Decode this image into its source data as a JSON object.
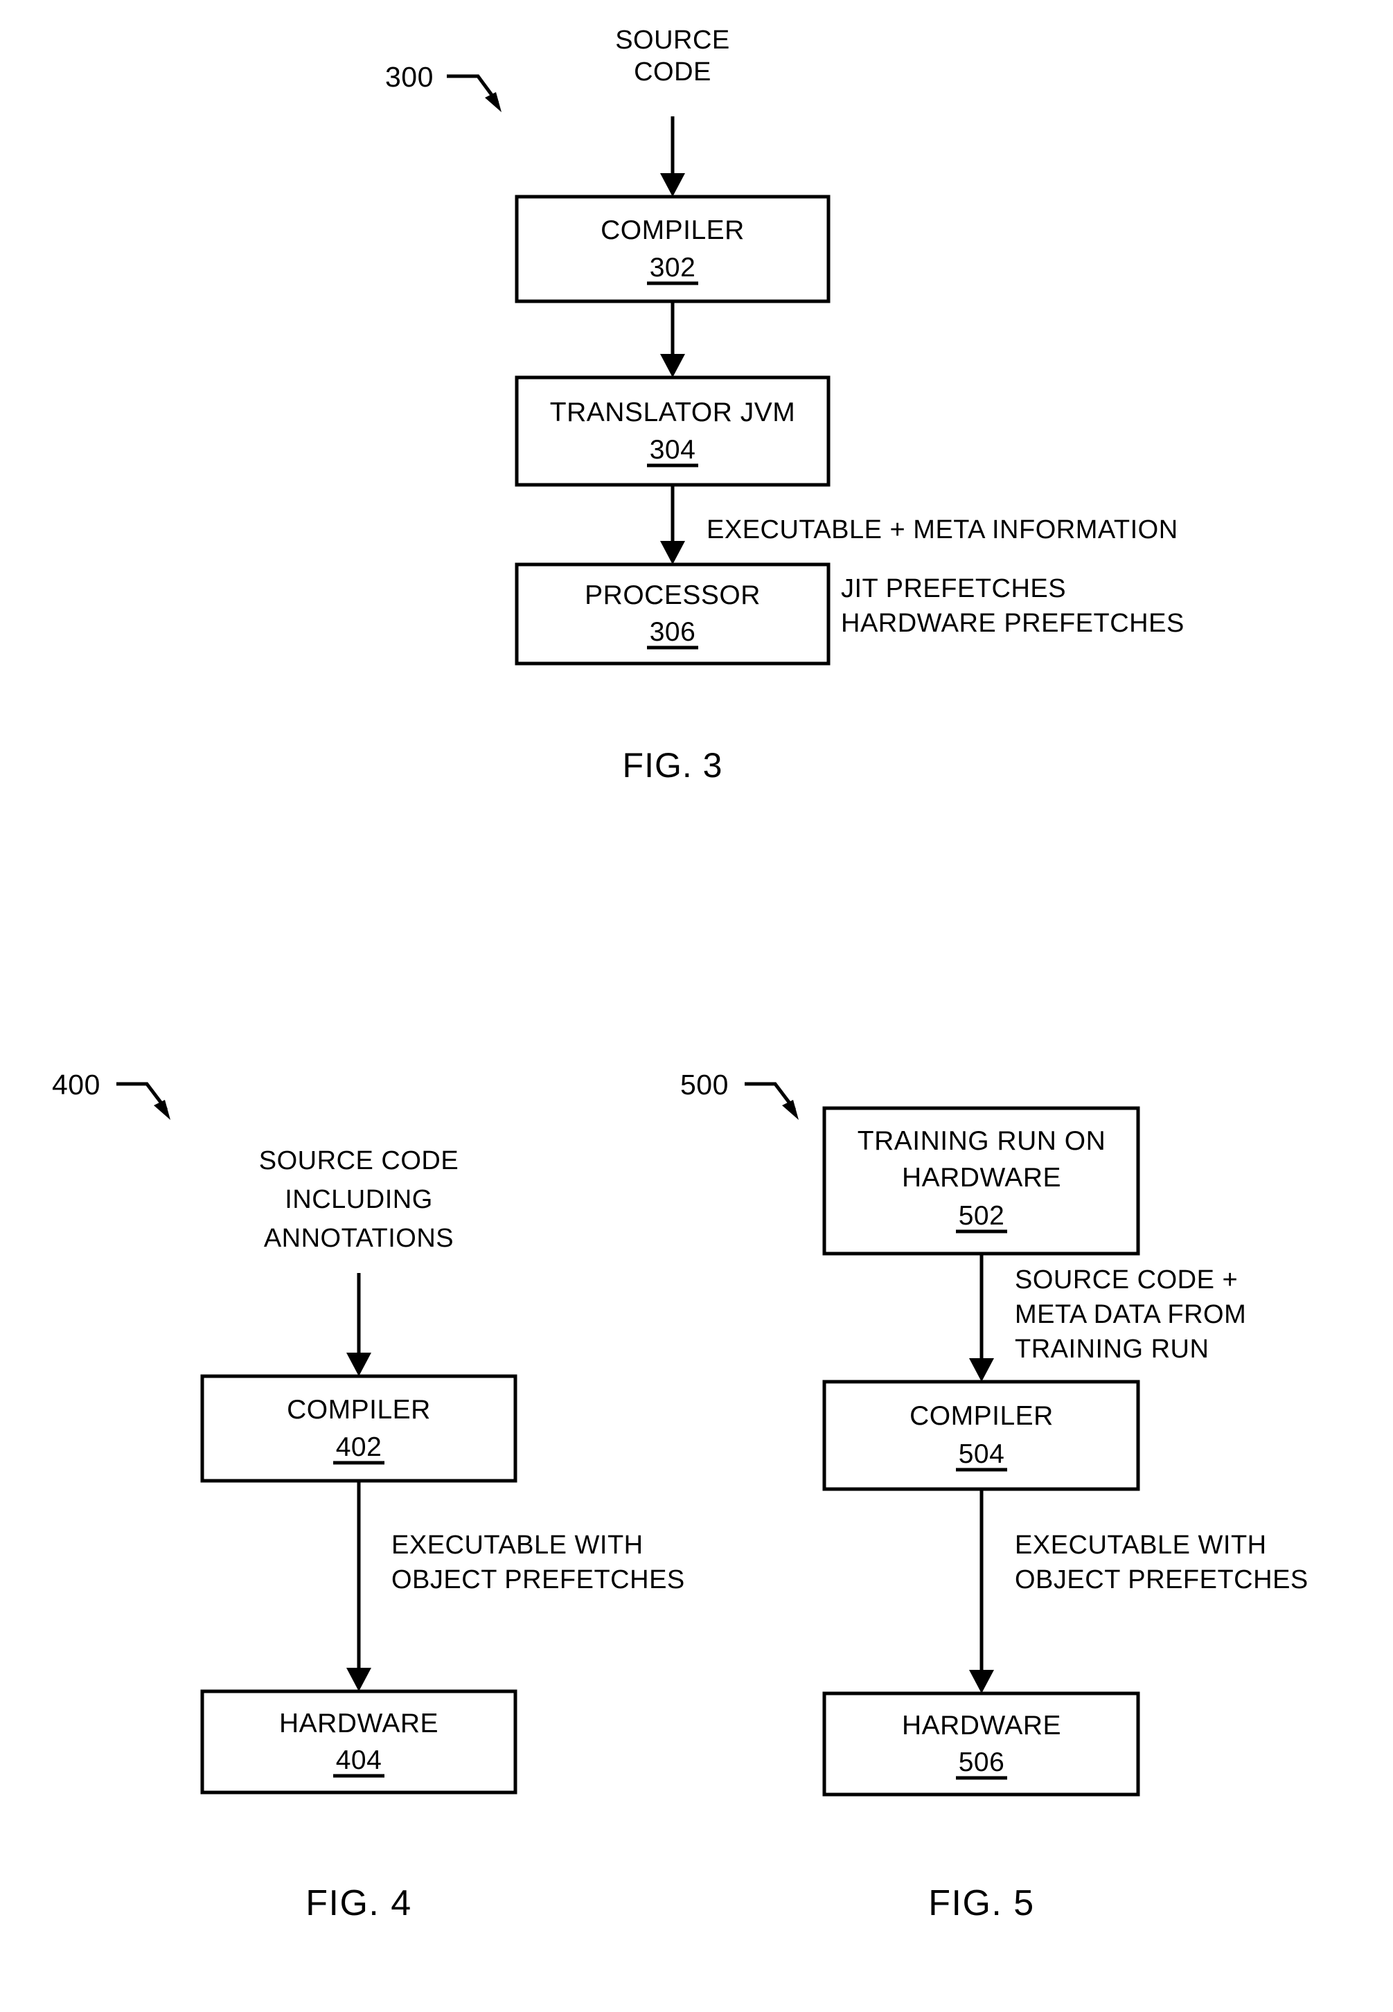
{
  "page": {
    "background_color": "#ffffff",
    "ink_color": "#000000",
    "kind": "patent-line-drawing"
  },
  "figures": [
    {
      "id": "fig3",
      "caption": "FIG. 3",
      "leader_label": "300",
      "input_label": "SOURCE\nCODE",
      "input_label_lines": [
        "SOURCE",
        "CODE"
      ],
      "boxes": [
        {
          "id": "box-302",
          "label": "COMPILER",
          "ref": "302"
        },
        {
          "id": "box-304",
          "label": "TRANSLATOR JVM",
          "ref": "304"
        },
        {
          "id": "box-306",
          "label": "PROCESSOR",
          "ref": "306"
        }
      ],
      "edge_labels": [
        {
          "id": "edge-302-304",
          "lines": []
        },
        {
          "id": "edge-304-306",
          "lines": [
            "EXECUTABLE + META INFORMATION"
          ]
        }
      ],
      "side_labels": [
        {
          "id": "side-jit",
          "text": "JIT PREFETCHES"
        },
        {
          "id": "side-hw",
          "text": "HARDWARE PREFETCHES"
        }
      ]
    },
    {
      "id": "fig4",
      "caption": "FIG. 4",
      "leader_label": "400",
      "input_label_lines": [
        "SOURCE CODE",
        "INCLUDING",
        "ANNOTATIONS"
      ],
      "boxes": [
        {
          "id": "box-402",
          "label": "COMPILER",
          "ref": "402"
        },
        {
          "id": "box-404",
          "label": "HARDWARE",
          "ref": "404"
        }
      ],
      "edge_labels": [
        {
          "id": "edge-402-404",
          "lines": [
            "EXECUTABLE WITH",
            "OBJECT PREFETCHES"
          ]
        }
      ]
    },
    {
      "id": "fig5",
      "caption": "FIG. 5",
      "leader_label": "500",
      "boxes": [
        {
          "id": "box-502",
          "label_lines": [
            "TRAINING RUN ON",
            "HARDWARE"
          ],
          "ref": "502"
        },
        {
          "id": "box-504",
          "label": "COMPILER",
          "ref": "504"
        },
        {
          "id": "box-506",
          "label": "HARDWARE",
          "ref": "506"
        }
      ],
      "edge_labels": [
        {
          "id": "edge-502-504",
          "lines": [
            "SOURCE CODE +",
            "META DATA FROM",
            "TRAINING RUN"
          ]
        },
        {
          "id": "edge-504-506",
          "lines": [
            "EXECUTABLE WITH",
            "OBJECT PREFETCHES"
          ]
        }
      ]
    }
  ],
  "text": {
    "fig3": {
      "leader": "300",
      "caption": "FIG. 3",
      "src_l1": "SOURCE",
      "src_l2": "CODE",
      "b302_label": "COMPILER",
      "b302_ref": "302",
      "b304_label": "TRANSLATOR JVM",
      "b304_ref": "304",
      "b306_label": "PROCESSOR",
      "b306_ref": "306",
      "edge_exec_meta": "EXECUTABLE + META INFORMATION",
      "side_jit": "JIT PREFETCHES",
      "side_hw": "HARDWARE PREFETCHES"
    },
    "fig4": {
      "leader": "400",
      "caption": "FIG. 4",
      "src_l1": "SOURCE CODE",
      "src_l2": "INCLUDING",
      "src_l3": "ANNOTATIONS",
      "b402_label": "COMPILER",
      "b402_ref": "402",
      "b404_label": "HARDWARE",
      "b404_ref": "404",
      "edge_l1": "EXECUTABLE WITH",
      "edge_l2": "OBJECT PREFETCHES"
    },
    "fig5": {
      "leader": "500",
      "caption": "FIG. 5",
      "b502_l1": "TRAINING RUN ON",
      "b502_l2": "HARDWARE",
      "b502_ref": "502",
      "b504_label": "COMPILER",
      "b504_ref": "504",
      "b506_label": "HARDWARE",
      "b506_ref": "506",
      "edge1_l1": "SOURCE CODE +",
      "edge1_l2": "META DATA FROM",
      "edge1_l3": "TRAINING RUN",
      "edge2_l1": "EXECUTABLE WITH",
      "edge2_l2": "OBJECT PREFETCHES"
    }
  }
}
